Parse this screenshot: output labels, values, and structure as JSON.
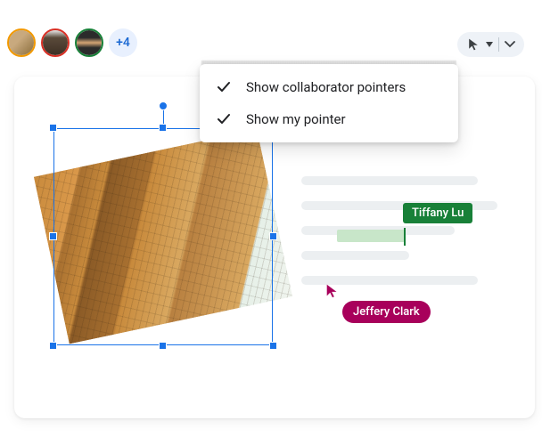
{
  "avatars": {
    "overflow_count": "+4"
  },
  "menu": {
    "item1": "Show collaborator pointers",
    "item2": "Show my pointer"
  },
  "collaborators": {
    "tiffany": {
      "name": "Tiffany Lu",
      "color": "#188038"
    },
    "jeffery": {
      "name": "Jeffery Clark",
      "color": "#a8005b"
    }
  }
}
